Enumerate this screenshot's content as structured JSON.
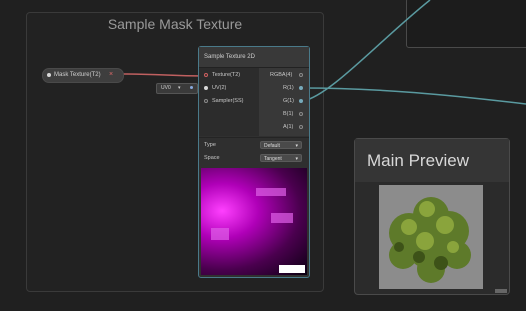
{
  "group": {
    "title": "Sample Mask Texture"
  },
  "property_node": {
    "label": "Mask Texture(T2)",
    "port_glyph": "×"
  },
  "uv_pill": {
    "label": "UV0",
    "arrow": "▾"
  },
  "sample_node": {
    "title": "Sample Texture 2D",
    "inputs": [
      "Texture(T2)",
      "UV(2)",
      "Sampler(SS)"
    ],
    "outputs": [
      "RGBA(4)",
      "R(1)",
      "G(1)",
      "B(1)",
      "A(1)"
    ],
    "settings": [
      {
        "label": "Type",
        "value": "Default"
      },
      {
        "label": "Space",
        "value": "Tangent"
      }
    ],
    "dropdown_glyph": "▾"
  },
  "main_preview": {
    "title": "Main Preview"
  },
  "colors": {
    "wire_red": "#c06060",
    "wire_teal": "#5a9aa0",
    "node_border": "#4a7a8a",
    "magenta": "#ff40ff"
  }
}
